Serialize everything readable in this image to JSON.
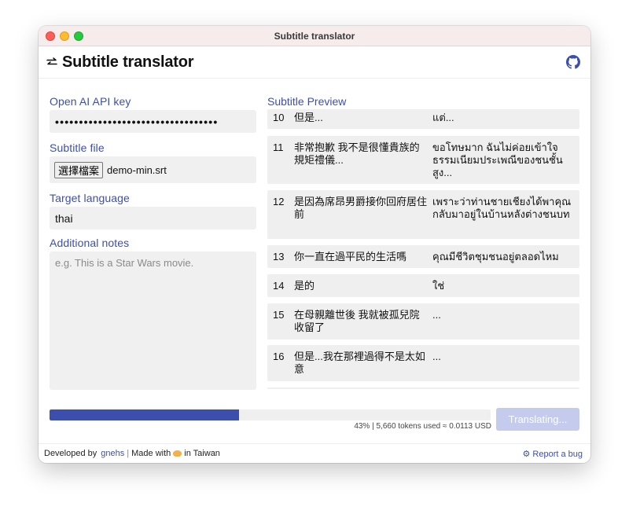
{
  "window": {
    "title": "Subtitle translator"
  },
  "header": {
    "title": "Subtitle translator",
    "icon": "swap-icon",
    "github_icon": "github-icon"
  },
  "form": {
    "api_key_label": "Open AI API key",
    "api_key_value": "••••••••••••••••••••••••••••••••••",
    "file_label": "Subtitle file",
    "file_button": "選擇檔案",
    "file_name": "demo-min.srt",
    "language_label": "Target language",
    "language_value": "thai",
    "notes_label": "Additional notes",
    "notes_placeholder": "e.g. This is a Star Wars movie."
  },
  "preview": {
    "label": "Subtitle Preview",
    "rows": [
      {
        "num": "10",
        "src": "但是...",
        "dst": "แต่..."
      },
      {
        "num": "11",
        "src": "非常抱歉 我不是很懂貴族的規矩禮儀...",
        "dst": "ขอโทษมาก ฉันไม่ค่อยเข้าใจธรรมเนียมประเพณีของชนชั้นสูง..."
      },
      {
        "num": "12",
        "src": "是因為席昂男爵接你回府居住前",
        "dst": "เพราะว่าท่านชายเชียงได้พาคุณกลับมาอยู่ในบ้านหลังต่างชนบท"
      },
      {
        "num": "13",
        "src": "你一直在過平民的生活嗎",
        "dst": "คุณมีชีวิตชุมชนอยู่ตลอดไหม"
      },
      {
        "num": "14",
        "src": "是的",
        "dst": "ใช่"
      },
      {
        "num": "15",
        "src": "在母親離世後 我就被孤兒院收留了",
        "dst": "..."
      },
      {
        "num": "16",
        "src": "但是...我在那裡過得不是太如意",
        "dst": "..."
      }
    ]
  },
  "progress": {
    "percent": 43,
    "text": "43% | 5,660 tokens used ≈ 0.0113 USD",
    "button": "Translating...",
    "fill_color": "#3d4fad"
  },
  "footer": {
    "developed_by": "Developed by",
    "author": "gnehs",
    "made_with": "Made with",
    "in_taiwan": "in Taiwan",
    "report": "Report a bug"
  }
}
